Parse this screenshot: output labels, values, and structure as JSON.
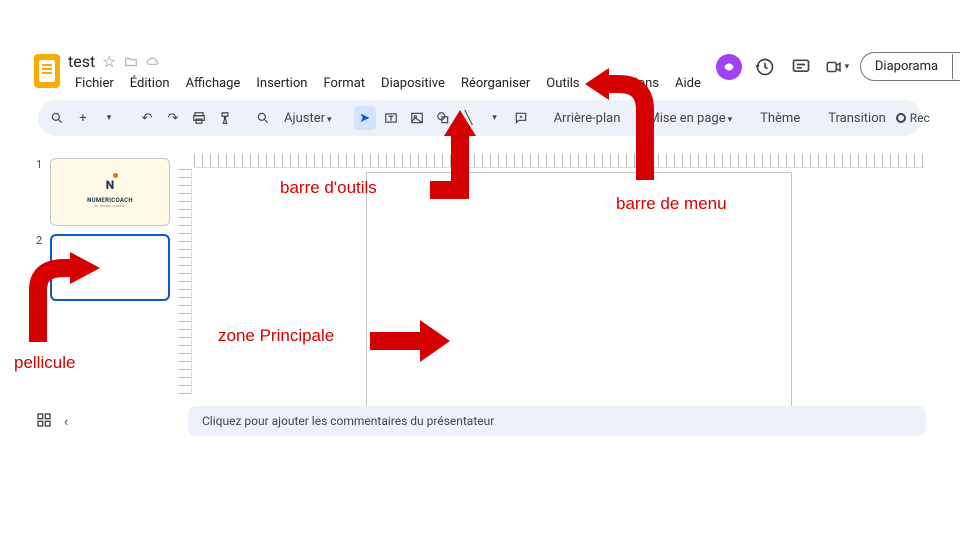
{
  "doc": {
    "name": "test"
  },
  "menubar": [
    "Fichier",
    "Édition",
    "Affichage",
    "Insertion",
    "Format",
    "Diapositive",
    "Réorganiser",
    "Outils",
    "Extensions",
    "Aide"
  ],
  "toolbar": {
    "zoom_label": "Ajuster",
    "background": "Arrière-plan",
    "layout": "Mise en page",
    "theme": "Thème",
    "transition": "Transition",
    "rec": "Rec"
  },
  "slideshow_label": "Diaporama",
  "slides": [
    {
      "num": "1",
      "logo_name": "NUMERICOACH",
      "logo_sub": "BY THIERRY VANOFFE"
    },
    {
      "num": "2"
    }
  ],
  "notes_placeholder": "Cliquez pour ajouter les commentaires du présentateur",
  "annotations": {
    "toolbar": "barre d'outils",
    "menubar": "barre de menu",
    "main": "zone Principale",
    "filmstrip": "pellicule"
  }
}
